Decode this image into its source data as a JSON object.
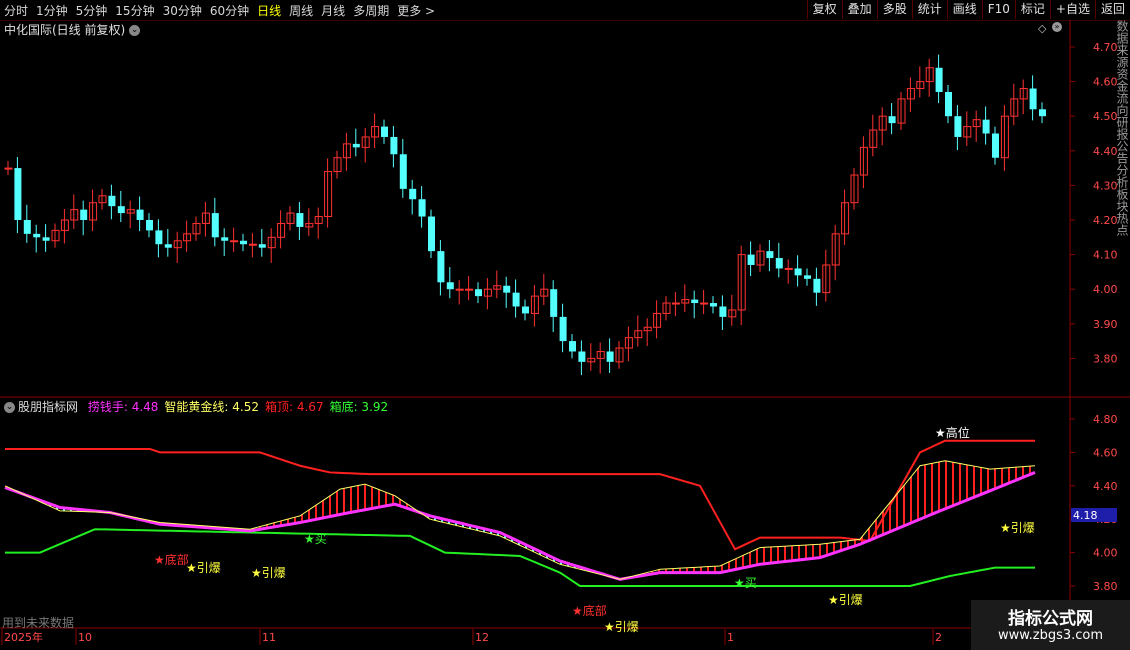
{
  "toolbar": {
    "periods": [
      "分时",
      "1分钟",
      "5分钟",
      "15分钟",
      "30分钟",
      "60分钟",
      "日线",
      "周线",
      "月线",
      "多周期",
      "更多 >"
    ],
    "active_period": "日线",
    "buttons": [
      "复权",
      "叠加",
      "多股",
      "统计",
      "画线",
      "F10",
      "标记",
      "+自选",
      "返回"
    ]
  },
  "main_chart": {
    "title": "中化国际(日线 前复权)",
    "price_labels": [
      "4.70",
      "4.60",
      "4.50",
      "4.40",
      "4.30",
      "4.20",
      "4.10",
      "4.00",
      "3.90",
      "3.80"
    ],
    "colors": {
      "up": "#ff3232",
      "down": "#54ffff",
      "grid": "#8b0000",
      "axis_text": "#ff4a4a"
    }
  },
  "indicator": {
    "name": "股朋指标网",
    "legend": [
      {
        "label": "捞钱手: 4.48",
        "color": "#ff33ff"
      },
      {
        "label": "智能黄金线: 4.52",
        "color": "#ffff66"
      },
      {
        "label": "箱顶: 4.67",
        "color": "#ff2020"
      },
      {
        "label": "箱底: 3.92",
        "color": "#33ff33"
      }
    ],
    "axis_labels": [
      "4.80",
      "4.60",
      "4.40",
      "4.20",
      "4.00",
      "3.80"
    ],
    "current_value_tag": "4.18",
    "markers": [
      {
        "text": "★底部",
        "color": "#ff3030"
      },
      {
        "text": "★引爆",
        "color": "#ffff40"
      },
      {
        "text": "★引爆",
        "color": "#ffff40"
      },
      {
        "text": "★买",
        "color": "#33ff33"
      },
      {
        "text": "★底部",
        "color": "#ff3030"
      },
      {
        "text": "★引爆",
        "color": "#ffff40"
      },
      {
        "text": "★买",
        "color": "#33ff33"
      },
      {
        "text": "★引爆",
        "color": "#ffff40"
      },
      {
        "text": "★高位",
        "color": "#ffffff"
      },
      {
        "text": "★引爆",
        "color": "#ffff40"
      }
    ],
    "footnote": "用到未来数据"
  },
  "time_axis": {
    "labels": [
      "2025年",
      "10",
      "11",
      "12",
      "1",
      "2"
    ]
  },
  "side_strip_text": "数据来源资金流向研报公告分析板块热点",
  "logo": {
    "line1": "指标公式网",
    "line2": "www.zbgs3.com"
  }
}
